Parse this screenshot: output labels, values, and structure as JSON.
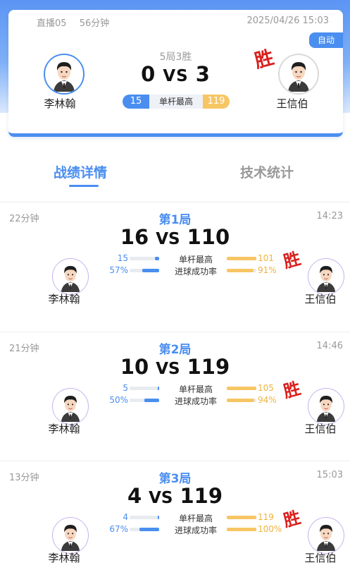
{
  "summary": {
    "channel": "直播05",
    "duration": "56分钟",
    "datetime": "2025/04/26 15:03",
    "auto_badge": "自动",
    "format": "5局3胜",
    "score_left": "0",
    "vs": "VS",
    "score_right": "3",
    "highest_break_label": "单杆最高",
    "highest_break_left": "15",
    "highest_break_right": "119",
    "win_label": "胜",
    "player_left": "李林翰",
    "player_right": "王信伯"
  },
  "tabs": {
    "details": "战绩详情",
    "stats": "技术统计"
  },
  "rounds": [
    {
      "duration": "22分钟",
      "title": "第1局",
      "time": "14:23",
      "score_left": "16",
      "vs": "VS",
      "score_right": "110",
      "break_label": "单杆最高",
      "break_left": "15",
      "break_right": "101",
      "rate_label": "进球成功率",
      "rate_left": "57%",
      "rate_right": "91%",
      "break_left_frac": 0.15,
      "break_right_frac": 1.0,
      "rate_left_frac": 0.57,
      "rate_right_frac": 0.91,
      "win_label": "胜",
      "player_left": "李林翰",
      "player_right": "王信伯"
    },
    {
      "duration": "21分钟",
      "title": "第2局",
      "time": "14:46",
      "score_left": "10",
      "vs": "VS",
      "score_right": "119",
      "break_label": "单杆最高",
      "break_left": "5",
      "break_right": "105",
      "rate_label": "进球成功率",
      "rate_left": "50%",
      "rate_right": "94%",
      "break_left_frac": 0.05,
      "break_right_frac": 1.0,
      "rate_left_frac": 0.5,
      "rate_right_frac": 0.94,
      "win_label": "胜",
      "player_left": "李林翰",
      "player_right": "王信伯"
    },
    {
      "duration": "13分钟",
      "title": "第3局",
      "time": "15:03",
      "score_left": "4",
      "vs": "VS",
      "score_right": "119",
      "break_label": "单杆最高",
      "break_left": "4",
      "break_right": "119",
      "rate_label": "进球成功率",
      "rate_left": "67%",
      "rate_right": "100%",
      "break_left_frac": 0.04,
      "break_right_frac": 1.0,
      "rate_left_frac": 0.67,
      "rate_right_frac": 1.0,
      "win_label": "胜",
      "player_left": "李林翰",
      "player_right": "王信伯"
    }
  ],
  "colors": {
    "accent": "#4a8ef0",
    "gold": "#f7c664",
    "win": "#d9201d"
  }
}
